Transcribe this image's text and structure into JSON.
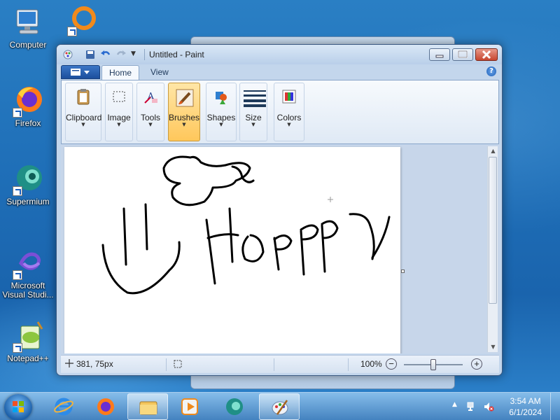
{
  "desktop": {
    "icons": [
      {
        "label": "Computer",
        "icon": "computer-icon"
      },
      {
        "label": "Firefox",
        "icon": "firefox-icon"
      },
      {
        "label": "Supermium",
        "icon": "supermium-icon"
      },
      {
        "label": "Microsoft Visual Studi...",
        "icon": "visual-studio-icon"
      },
      {
        "label": "Notepad++",
        "icon": "notepad-plus-plus-icon"
      }
    ]
  },
  "window": {
    "title": "Untitled - Paint",
    "tabs": [
      "Home",
      "View"
    ],
    "active_tab": "Home",
    "groups": [
      {
        "label": "Clipboard",
        "icon": "clipboard-icon"
      },
      {
        "label": "Image",
        "icon": "select-image-icon"
      },
      {
        "label": "Tools",
        "icon": "tools-icon"
      },
      {
        "label": "Brushes",
        "icon": "brush-icon",
        "active": true
      },
      {
        "label": "Shapes",
        "icon": "shapes-icon"
      },
      {
        "label": "Size",
        "icon": "size-icon"
      },
      {
        "label": "Colors",
        "icon": "colors-icon"
      }
    ]
  },
  "status": {
    "cursor_position": "381, 75px",
    "zoom": "100%"
  },
  "taskbar": {
    "time": "3:54 AM",
    "date": "6/1/2024",
    "apps": [
      "ie-icon",
      "firefox-icon",
      "explorer-icon",
      "media-player-icon",
      "supermium-icon",
      "paint-icon"
    ]
  },
  "colors": {
    "accent": "#1c4f9d",
    "active_group": "#ffc75b",
    "close_button": "#c7462f"
  }
}
